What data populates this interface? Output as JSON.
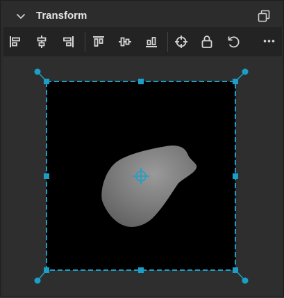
{
  "panel": {
    "title": "Transform",
    "accent_color": "#1aa0c8"
  },
  "header": {
    "collapse_icon": "chevron-down-icon",
    "popout_icon": "popout-window-icon"
  },
  "toolbar": {
    "buttons": [
      {
        "icon": "align-left-icon"
      },
      {
        "icon": "align-center-horizontal-icon"
      },
      {
        "icon": "align-right-icon"
      },
      {
        "icon": "align-top-icon"
      },
      {
        "icon": "align-center-vertical-icon"
      },
      {
        "icon": "align-bottom-icon"
      },
      {
        "icon": "crosshair-icon"
      },
      {
        "icon": "lock-icon"
      },
      {
        "icon": "reset-icon"
      },
      {
        "icon": "more-icon"
      }
    ]
  },
  "canvas": {
    "background": "#000000",
    "selection_color": "#1aa0c8"
  }
}
